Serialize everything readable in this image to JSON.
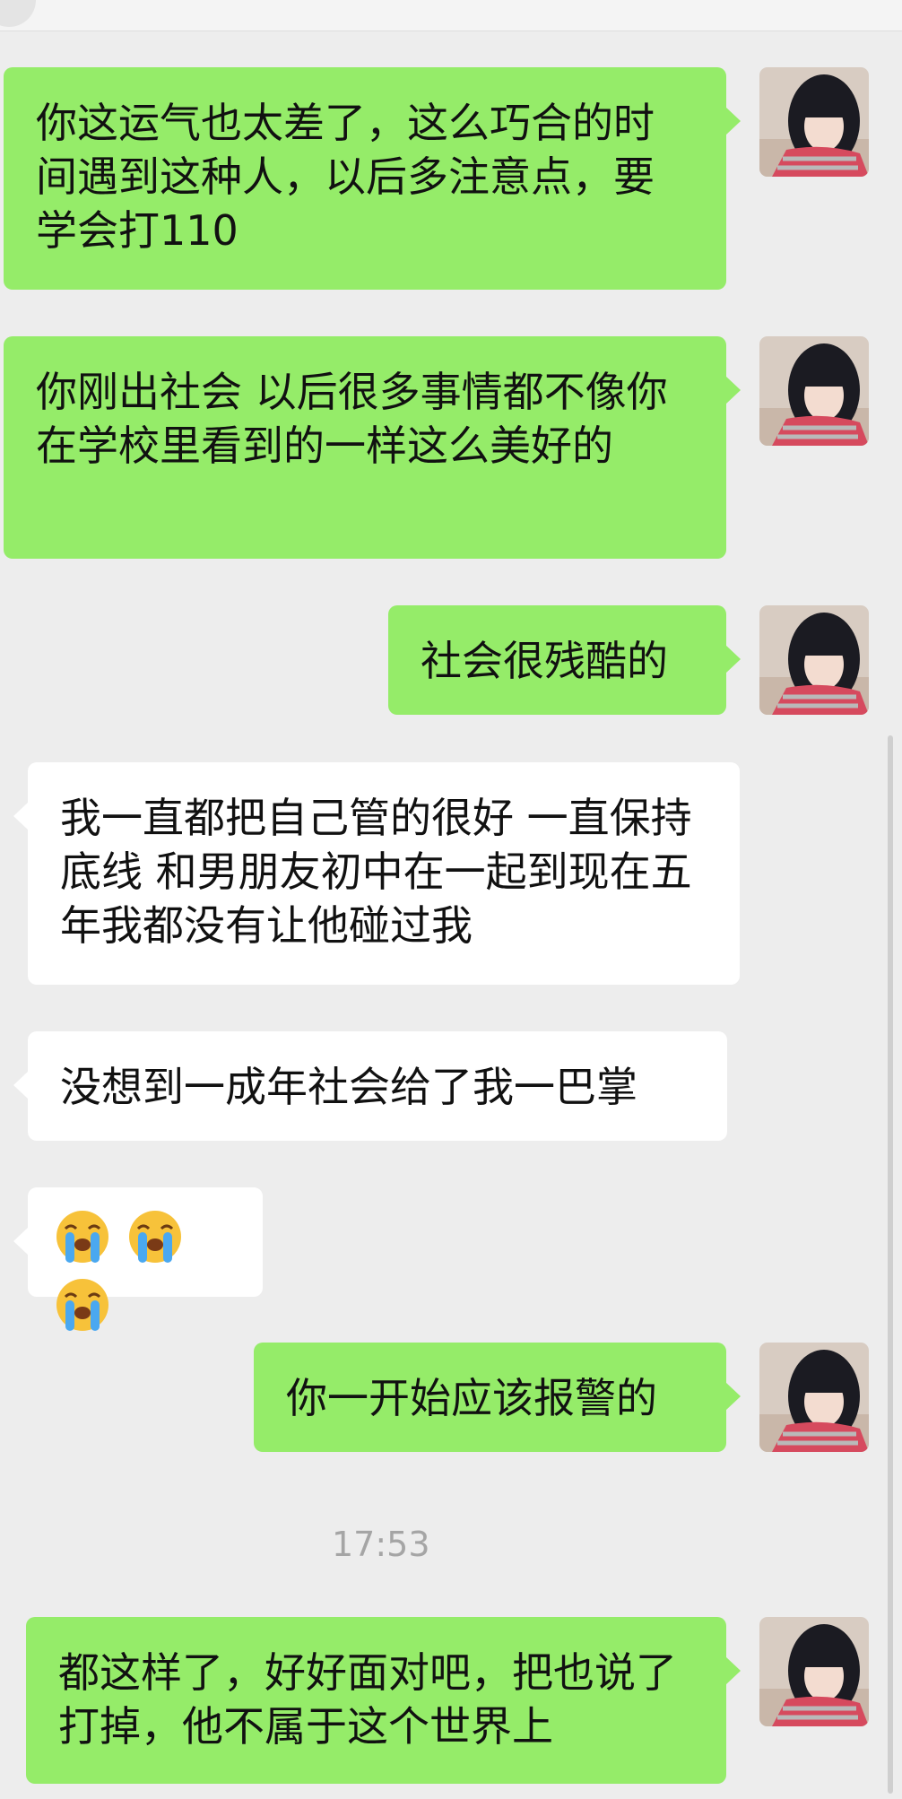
{
  "chat": {
    "messages": [
      {
        "side": "right",
        "text": "你这运气也太差了，这么巧合的时间遇到这种人，以后多注意点，要学会打110"
      },
      {
        "side": "right",
        "text": "你刚出社会  以后很多事情都不像你在学校里看到的一样这么美好的"
      },
      {
        "side": "right",
        "text": "社会很残酷的"
      },
      {
        "side": "left",
        "text": "我一直都把自己管的很好 一直保持底线 和男朋友初中在一起到现在五年我都没有让他碰过我"
      },
      {
        "side": "left",
        "text": "没想到一成年社会给了我一巴掌"
      },
      {
        "side": "left",
        "emoji": [
          "loudly-crying-face",
          "loudly-crying-face",
          "loudly-crying-face"
        ]
      },
      {
        "side": "right",
        "text": "你一开始应该报警的"
      },
      {
        "side": "right",
        "text": "都这样了，好好面对吧，把也说了打掉，他不属于这个世界上"
      }
    ],
    "timestamp": "17:53"
  },
  "colors": {
    "background": "#ededed",
    "sent_bubble": "#95ec69",
    "received_bubble": "#ffffff",
    "timestamp_text": "#a5a5a5"
  }
}
